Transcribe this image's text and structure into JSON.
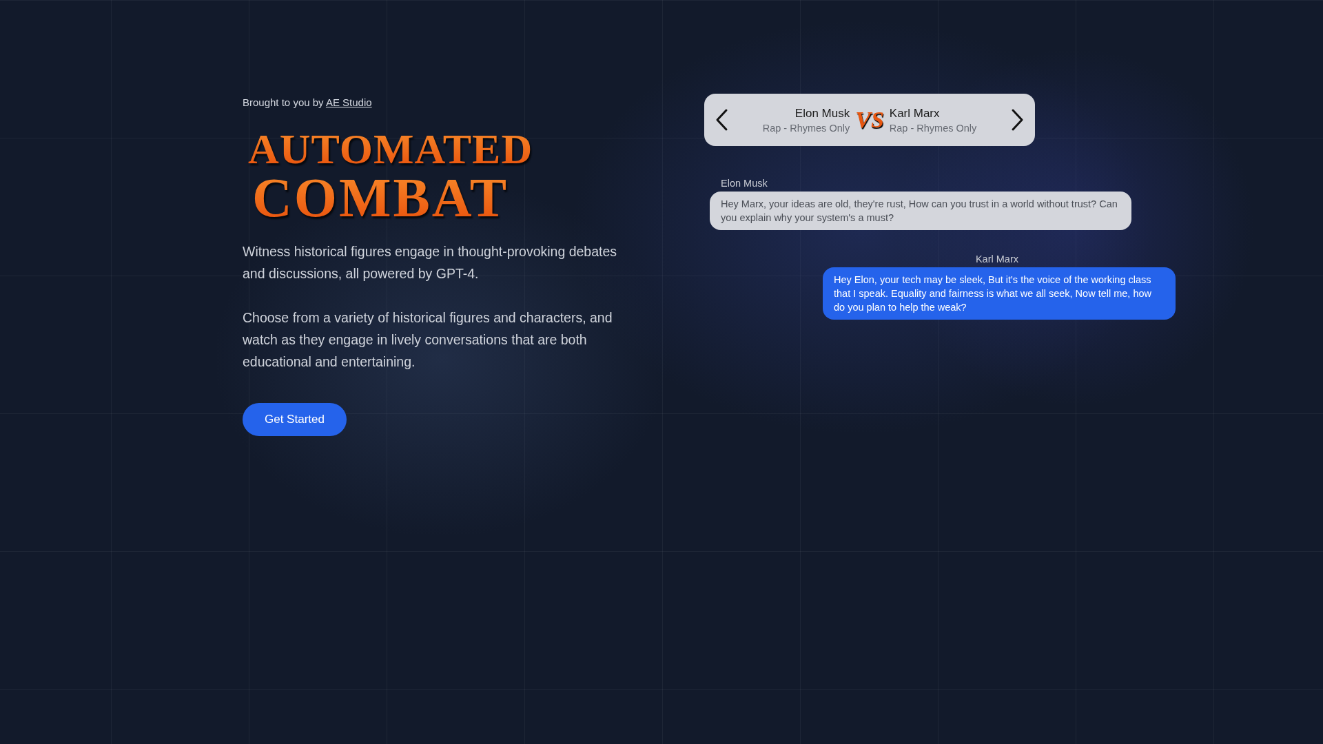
{
  "credit": {
    "prefix": "Brought to you by",
    "link": "AE Studio"
  },
  "title": [
    "AUTOMATED",
    "COMBAT"
  ],
  "paragraphs": [
    "Witness historical figures engage in thought-provoking debates and discussions, all powered by GPT-4.",
    "Choose from a variety of historical figures and characters, and watch as they engage in lively conversations that are both educational and entertaining."
  ],
  "cta": "Get Started",
  "matchup": {
    "left": {
      "name": "Elon Musk",
      "style": "Rap - Rhymes Only"
    },
    "vs": "VS",
    "right": {
      "name": "Karl Marx",
      "style": "Rap - Rhymes Only"
    }
  },
  "messages": [
    {
      "kind": "left",
      "speaker": "Elon Musk",
      "text": "Hey Marx, your ideas are old, they're rust, How can you trust in a world without trust? Can you explain why your system's a must?"
    },
    {
      "kind": "right",
      "speaker": "Karl Marx",
      "text": "Hey Elon, your tech may be sleek, But it's the voice of the working class that I speak. Equality and fairness is what we all seek, Now tell me, how do you plan to help the weak?"
    }
  ]
}
